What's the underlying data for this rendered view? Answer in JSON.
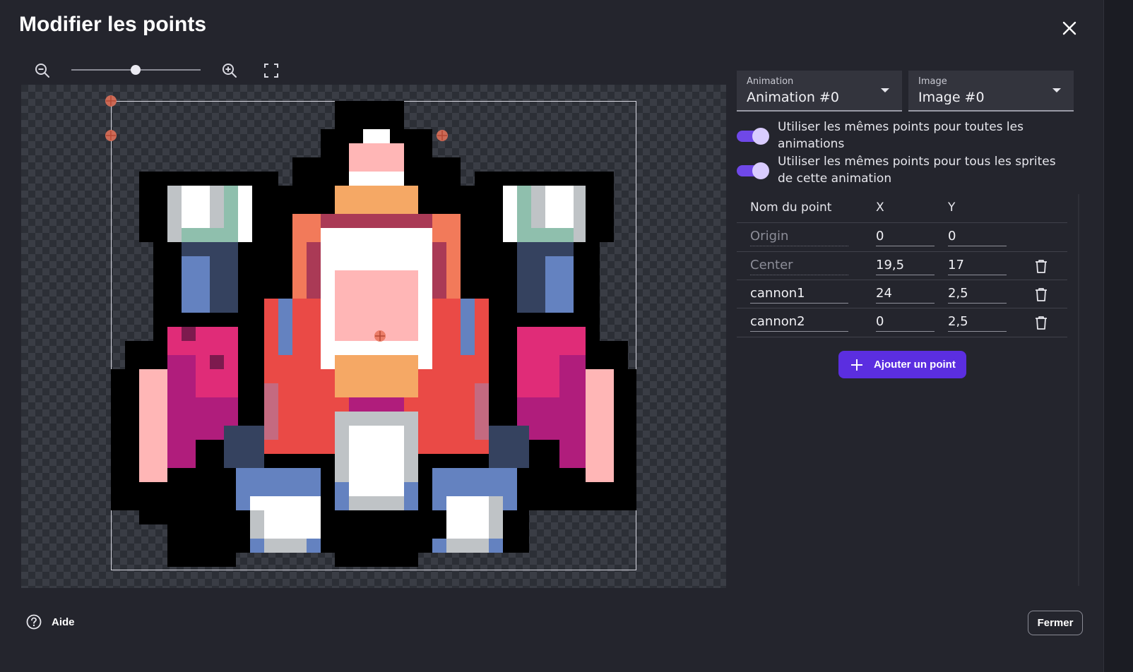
{
  "dialog": {
    "title": "Modifier les points",
    "close_icon": "close-icon"
  },
  "zoom": {
    "zoom_out_icon": "zoom-out-icon",
    "zoom_in_icon": "zoom-in-icon",
    "fit_icon": "fit-screen-icon",
    "level": 0.5
  },
  "selectors": {
    "animation": {
      "label": "Animation",
      "value": "Animation #0"
    },
    "image": {
      "label": "Image",
      "value": "Image #0"
    }
  },
  "toggles": [
    {
      "label": "Utiliser les mêmes points pour toutes les animations",
      "on": true
    },
    {
      "label": "Utiliser les mêmes points pour tous les sprites de cette animation",
      "on": true
    }
  ],
  "points_table": {
    "headers": {
      "name": "Nom du point",
      "x": "X",
      "y": "Y"
    },
    "rows": [
      {
        "name": "Origin",
        "x": "0",
        "y": "0",
        "deletable": false
      },
      {
        "name": "Center",
        "x": "19,5",
        "y": "17",
        "deletable": true
      },
      {
        "name": "cannon1",
        "x": "24",
        "y": "2,5",
        "deletable": true
      },
      {
        "name": "cannon2",
        "x": "0",
        "y": "2,5",
        "deletable": true
      }
    ]
  },
  "add_point_label": "Ajouter un point",
  "footer": {
    "help_label": "Aide",
    "close_label": "Fermer"
  },
  "colors": {
    "accent": "#5b2ee0",
    "toggle": "#6f48e8",
    "marker": "#e8735a"
  }
}
